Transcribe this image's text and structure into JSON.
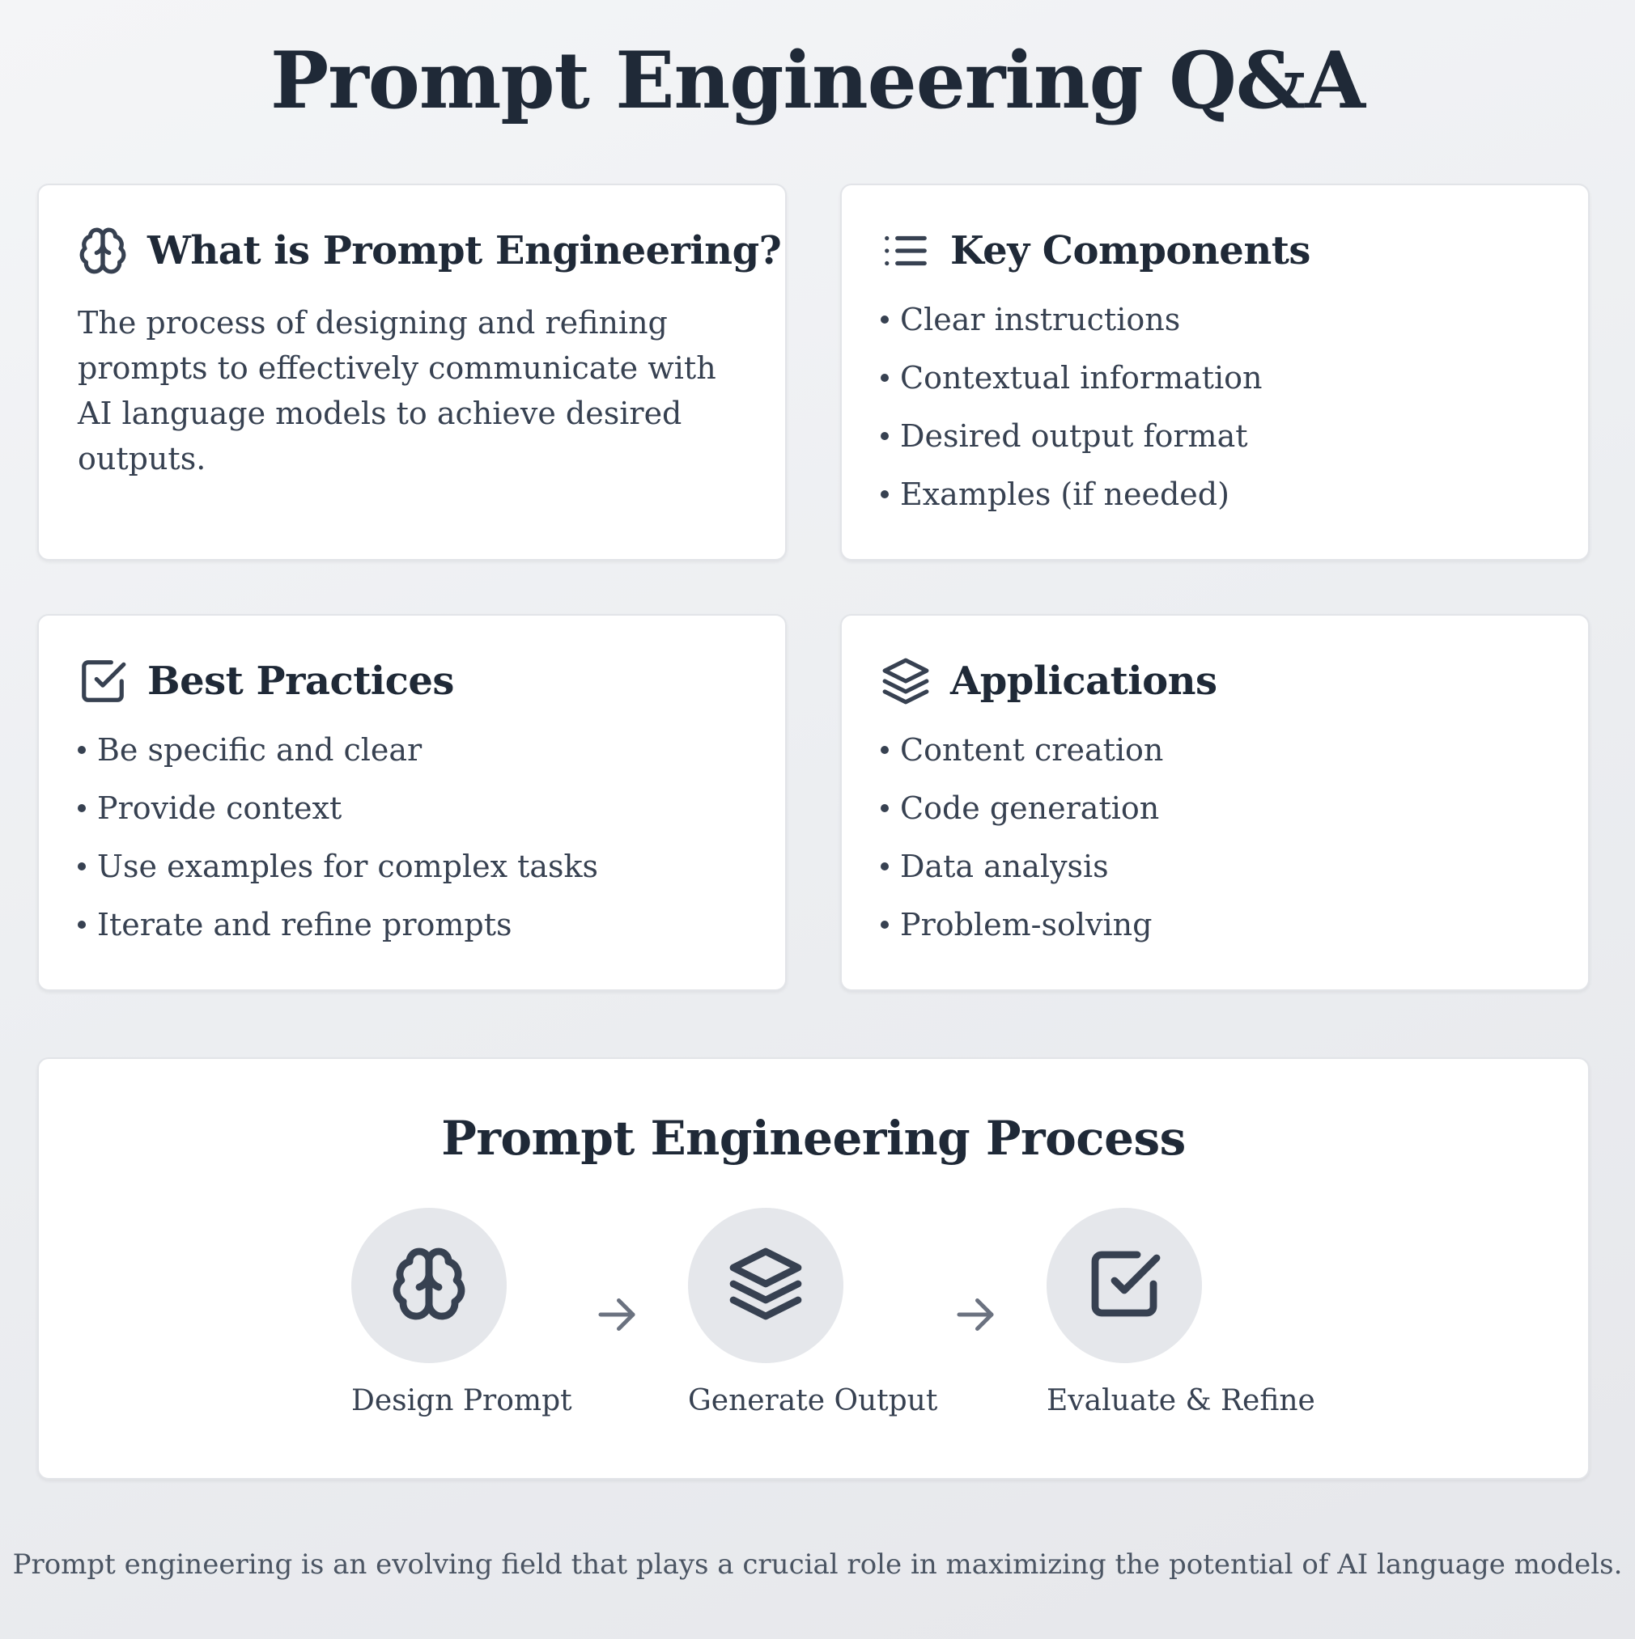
{
  "page": {
    "title": "Prompt Engineering Q&A"
  },
  "cards": {
    "what": {
      "icon": "brain-icon",
      "title": "What is Prompt Engineering?",
      "body": "The process of designing and refining prompts to effectively communicate with AI language models to achieve desired outputs."
    },
    "components": {
      "icon": "list-icon",
      "title": "Key Components",
      "items": [
        "Clear instructions",
        "Contextual information",
        "Desired output format",
        "Examples (if needed)"
      ]
    },
    "practices": {
      "icon": "check-square-icon",
      "title": "Best Practices",
      "items": [
        "Be specific and clear",
        "Provide context",
        "Use examples for complex tasks",
        "Iterate and refine prompts"
      ]
    },
    "applications": {
      "icon": "layers-icon",
      "title": "Applications",
      "items": [
        "Content creation",
        "Code generation",
        "Data analysis",
        "Problem-solving"
      ]
    }
  },
  "process": {
    "title": "Prompt Engineering Process",
    "steps": [
      {
        "label": "Design Prompt",
        "icon": "brain-icon"
      },
      {
        "label": "Generate Output",
        "icon": "layers-icon"
      },
      {
        "label": "Evaluate & Refine",
        "icon": "check-square-icon"
      }
    ],
    "arrow_icon": "arrow-right-icon"
  },
  "footer": {
    "note": "Prompt engineering is an evolving field that plays a crucial role in maximizing the potential of AI language models."
  },
  "colors": {
    "text_primary": "#1f2937",
    "text_body": "#374151",
    "text_muted": "#4b5563",
    "card_bg": "#ffffff",
    "card_border": "#e2e4e8",
    "step_circle_bg": "#e5e7eb",
    "arrow": "#6b7280"
  }
}
